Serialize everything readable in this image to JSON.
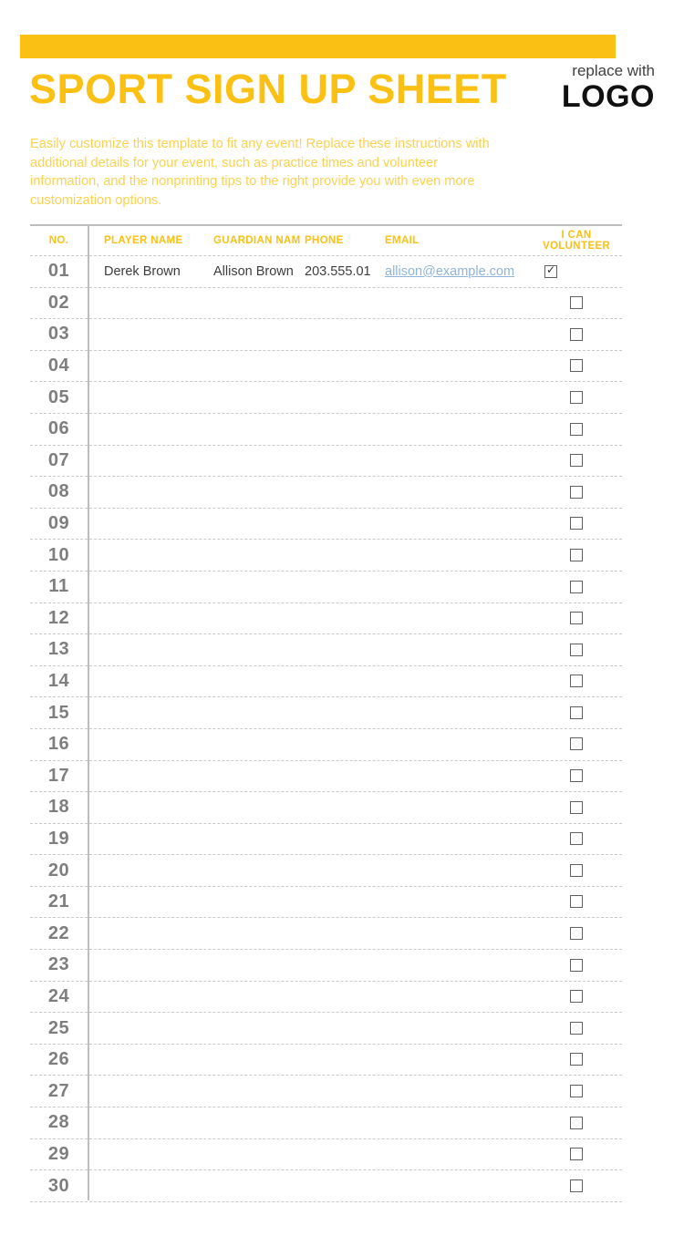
{
  "document": {
    "title": "SPORT SIGN UP SHEET",
    "accent_color": "#FAC013",
    "logo": {
      "line1": "replace with",
      "line2": "LOGO"
    },
    "instructions": "Easily customize this template to fit any event! Replace these instructions with additional details for your event, such as practice times and volunteer information, and the nonprinting tips to the right provide you with even more customization options."
  },
  "table": {
    "headers": {
      "no": "NO.",
      "player_name": "PLAYER NAME",
      "guardian_name": "GUARDIAN NAM",
      "phone": "PHONE",
      "email": "EMAIL",
      "volunteer": "I CAN VOLUNTEER"
    },
    "rows": [
      {
        "no": "01",
        "player_name": "Derek Brown",
        "guardian_name": "Allison Brown",
        "phone": "203.555.01",
        "email": "allison@example.com",
        "volunteer": true
      },
      {
        "no": "02",
        "player_name": "",
        "guardian_name": "",
        "phone": "",
        "email": "",
        "volunteer": false
      },
      {
        "no": "03",
        "player_name": "",
        "guardian_name": "",
        "phone": "",
        "email": "",
        "volunteer": false
      },
      {
        "no": "04",
        "player_name": "",
        "guardian_name": "",
        "phone": "",
        "email": "",
        "volunteer": false
      },
      {
        "no": "05",
        "player_name": "",
        "guardian_name": "",
        "phone": "",
        "email": "",
        "volunteer": false
      },
      {
        "no": "06",
        "player_name": "",
        "guardian_name": "",
        "phone": "",
        "email": "",
        "volunteer": false
      },
      {
        "no": "07",
        "player_name": "",
        "guardian_name": "",
        "phone": "",
        "email": "",
        "volunteer": false
      },
      {
        "no": "08",
        "player_name": "",
        "guardian_name": "",
        "phone": "",
        "email": "",
        "volunteer": false
      },
      {
        "no": "09",
        "player_name": "",
        "guardian_name": "",
        "phone": "",
        "email": "",
        "volunteer": false
      },
      {
        "no": "10",
        "player_name": "",
        "guardian_name": "",
        "phone": "",
        "email": "",
        "volunteer": false
      },
      {
        "no": "11",
        "player_name": "",
        "guardian_name": "",
        "phone": "",
        "email": "",
        "volunteer": false
      },
      {
        "no": "12",
        "player_name": "",
        "guardian_name": "",
        "phone": "",
        "email": "",
        "volunteer": false
      },
      {
        "no": "13",
        "player_name": "",
        "guardian_name": "",
        "phone": "",
        "email": "",
        "volunteer": false
      },
      {
        "no": "14",
        "player_name": "",
        "guardian_name": "",
        "phone": "",
        "email": "",
        "volunteer": false
      },
      {
        "no": "15",
        "player_name": "",
        "guardian_name": "",
        "phone": "",
        "email": "",
        "volunteer": false
      },
      {
        "no": "16",
        "player_name": "",
        "guardian_name": "",
        "phone": "",
        "email": "",
        "volunteer": false
      },
      {
        "no": "17",
        "player_name": "",
        "guardian_name": "",
        "phone": "",
        "email": "",
        "volunteer": false
      },
      {
        "no": "18",
        "player_name": "",
        "guardian_name": "",
        "phone": "",
        "email": "",
        "volunteer": false
      },
      {
        "no": "19",
        "player_name": "",
        "guardian_name": "",
        "phone": "",
        "email": "",
        "volunteer": false
      },
      {
        "no": "20",
        "player_name": "",
        "guardian_name": "",
        "phone": "",
        "email": "",
        "volunteer": false
      },
      {
        "no": "21",
        "player_name": "",
        "guardian_name": "",
        "phone": "",
        "email": "",
        "volunteer": false
      },
      {
        "no": "22",
        "player_name": "",
        "guardian_name": "",
        "phone": "",
        "email": "",
        "volunteer": false
      },
      {
        "no": "23",
        "player_name": "",
        "guardian_name": "",
        "phone": "",
        "email": "",
        "volunteer": false
      },
      {
        "no": "24",
        "player_name": "",
        "guardian_name": "",
        "phone": "",
        "email": "",
        "volunteer": false
      },
      {
        "no": "25",
        "player_name": "",
        "guardian_name": "",
        "phone": "",
        "email": "",
        "volunteer": false
      },
      {
        "no": "26",
        "player_name": "",
        "guardian_name": "",
        "phone": "",
        "email": "",
        "volunteer": false
      },
      {
        "no": "27",
        "player_name": "",
        "guardian_name": "",
        "phone": "",
        "email": "",
        "volunteer": false
      },
      {
        "no": "28",
        "player_name": "",
        "guardian_name": "",
        "phone": "",
        "email": "",
        "volunteer": false
      },
      {
        "no": "29",
        "player_name": "",
        "guardian_name": "",
        "phone": "",
        "email": "",
        "volunteer": false
      },
      {
        "no": "30",
        "player_name": "",
        "guardian_name": "",
        "phone": "",
        "email": "",
        "volunteer": false
      }
    ]
  }
}
